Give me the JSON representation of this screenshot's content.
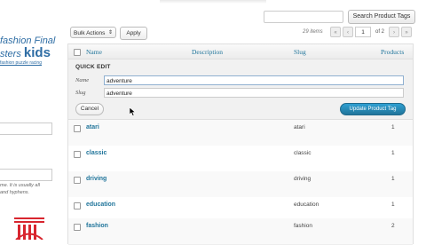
{
  "sidebar": {
    "logo_line1": "fashion  Final",
    "logo_line2": "sters",
    "logo_kids": "kids",
    "logo_links": "fashion puzzle racing",
    "hint_line1": "me. It is usually all",
    "hint_line2": "and hyphens."
  },
  "search": {
    "button_label": "Search Product Tags",
    "value": ""
  },
  "toolbar": {
    "bulk_actions": "Bulk Actions",
    "apply_label": "Apply",
    "items_count": "29 items",
    "first_page": "«",
    "prev_page": "‹",
    "current_page": "1",
    "of_pages": "of 2",
    "next_page": "›",
    "last_page": "»"
  },
  "table": {
    "columns": {
      "name": "Name",
      "description": "Description",
      "slug": "Slug",
      "products": "Products"
    },
    "quick_edit": {
      "title": "QUICK EDIT",
      "name_label": "Name",
      "name_value": "adventure",
      "slug_label": "Slug",
      "slug_value": "adventure",
      "cancel_label": "Cancel",
      "update_label": "Update Product Tag"
    },
    "rows": [
      {
        "name": "atari",
        "slug": "atari",
        "count": "1"
      },
      {
        "name": "classic",
        "slug": "classic",
        "count": "1"
      },
      {
        "name": "driving",
        "slug": "driving",
        "count": "1"
      },
      {
        "name": "education",
        "slug": "education",
        "count": "1"
      },
      {
        "name": "fashion",
        "slug": "fashion",
        "count": "2"
      }
    ]
  },
  "colors": {
    "link": "#21759b",
    "primary_button": "#21759b",
    "logo_red": "#d8262f"
  }
}
